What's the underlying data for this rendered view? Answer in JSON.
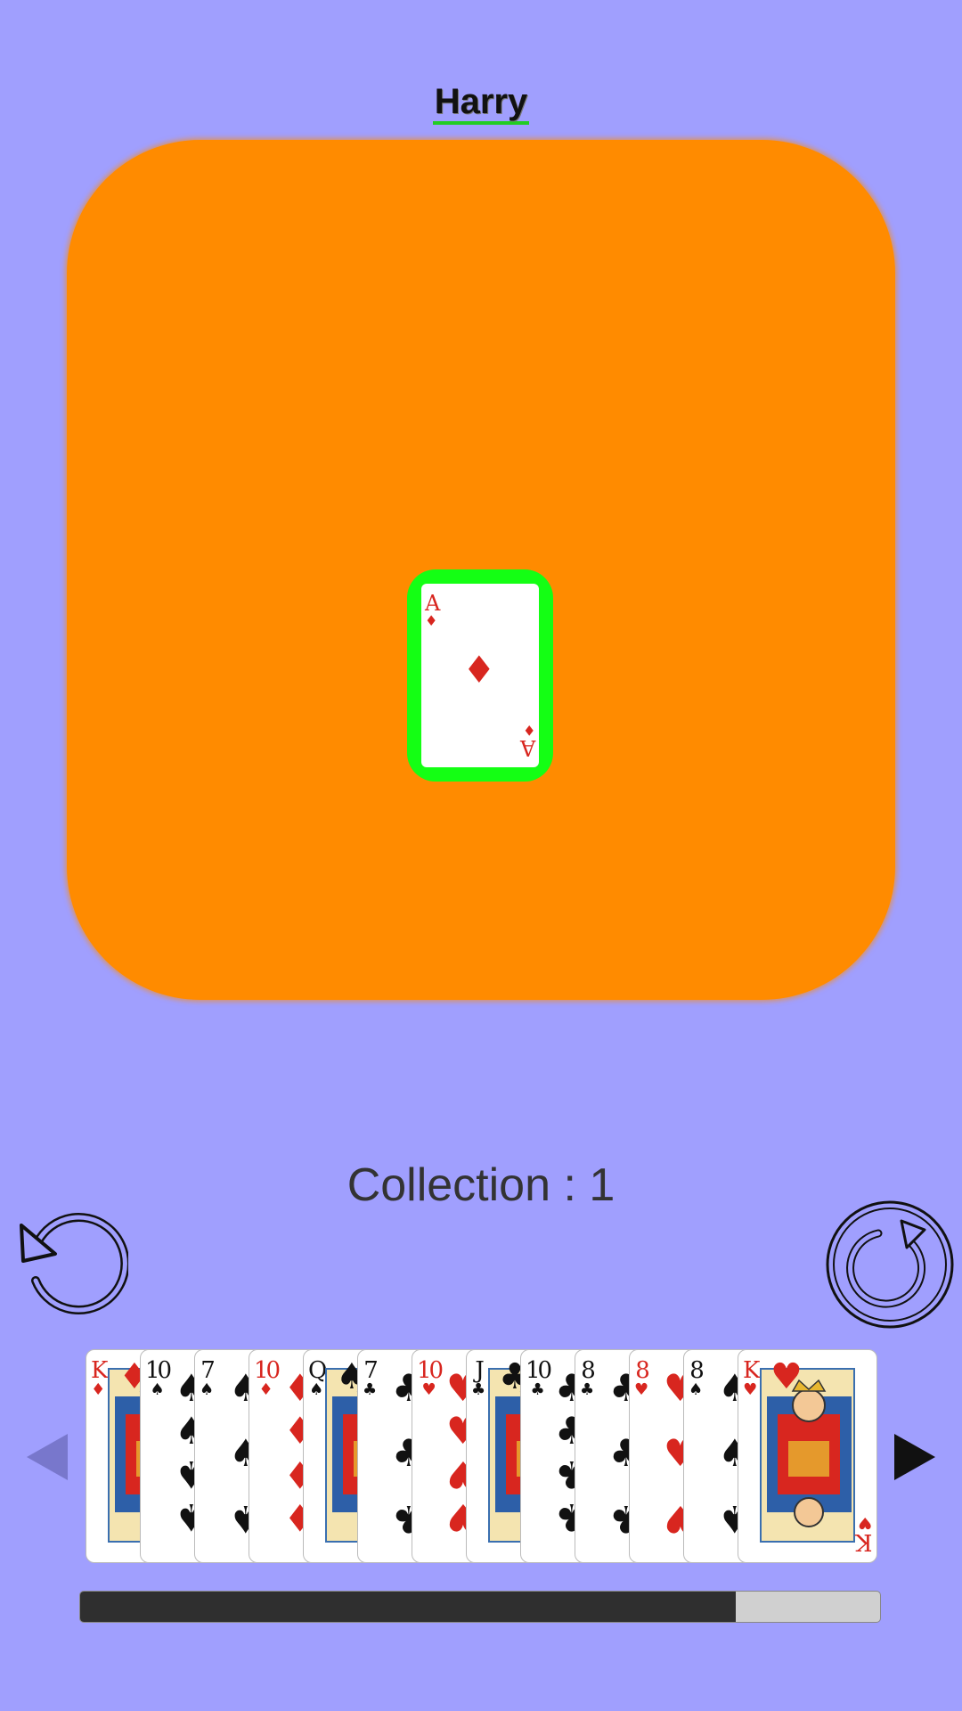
{
  "player": {
    "name": "Harry"
  },
  "table": {
    "played_card": {
      "rank": "A",
      "suit": "♦",
      "color": "red"
    }
  },
  "collection_text": "Collection : 1",
  "controls": {
    "undo_icon": "undo-arrow-icon",
    "redo_icon": "redo-circle-icon",
    "prev_icon": "triangle-left-icon",
    "next_icon": "triangle-right-icon"
  },
  "hand": [
    {
      "rank": "K",
      "suit": "♦",
      "color": "red",
      "face": true
    },
    {
      "rank": "10",
      "suit": "♠",
      "color": "black",
      "face": false
    },
    {
      "rank": "7",
      "suit": "♠",
      "color": "black",
      "face": false
    },
    {
      "rank": "10",
      "suit": "♦",
      "color": "red",
      "face": false
    },
    {
      "rank": "Q",
      "suit": "♠",
      "color": "black",
      "face": true
    },
    {
      "rank": "7",
      "suit": "♣",
      "color": "black",
      "face": false
    },
    {
      "rank": "10",
      "suit": "♥",
      "color": "red",
      "face": false
    },
    {
      "rank": "J",
      "suit": "♣",
      "color": "black",
      "face": true
    },
    {
      "rank": "10",
      "suit": "♣",
      "color": "black",
      "face": false
    },
    {
      "rank": "8",
      "suit": "♣",
      "color": "black",
      "face": false
    },
    {
      "rank": "8",
      "suit": "♥",
      "color": "red",
      "face": false
    },
    {
      "rank": "8",
      "suit": "♠",
      "color": "black",
      "face": false
    },
    {
      "rank": "K",
      "suit": "♥",
      "color": "red",
      "face": true
    }
  ],
  "progress": {
    "fraction": 0.82
  },
  "colors": {
    "background": "#a09ffe",
    "table": "#ff8b00",
    "highlight": "#14ff14",
    "progress_fill": "#2f2f2f",
    "progress_track": "#d0d0d0"
  }
}
